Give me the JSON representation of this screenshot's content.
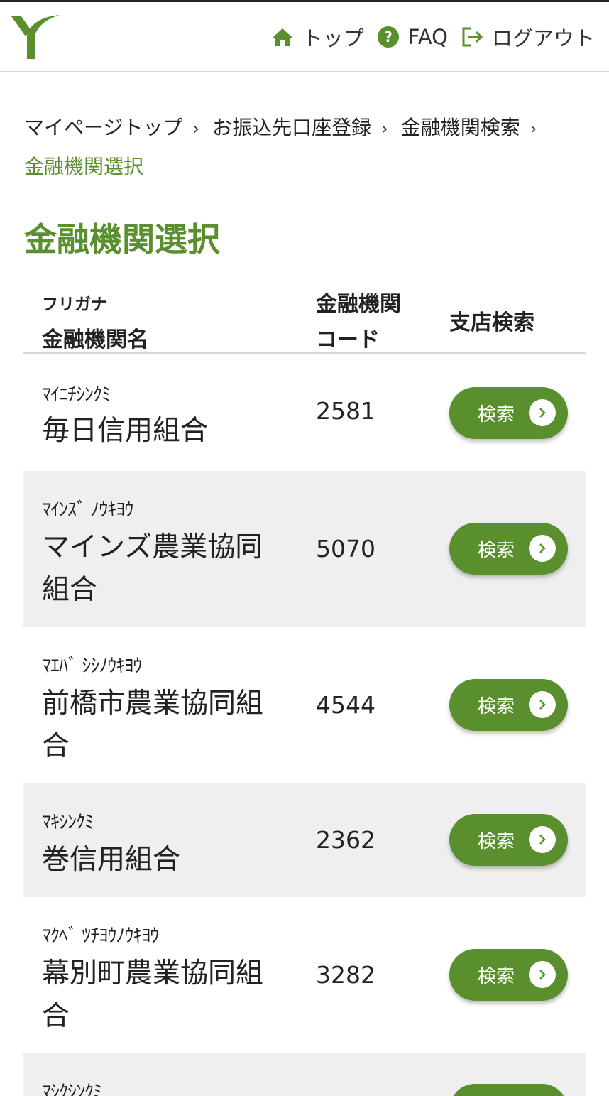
{
  "header": {
    "nav": [
      {
        "label": "トップ",
        "icon": "home-icon"
      },
      {
        "label": "FAQ",
        "icon": "help-icon"
      },
      {
        "label": "ログアウト",
        "icon": "logout-icon"
      }
    ]
  },
  "colors": {
    "accent": "#5a8f2d",
    "row_alt": "#efefef"
  },
  "breadcrumb": {
    "items": [
      "マイページトップ",
      "お振込先口座登録",
      "金融機関検索"
    ],
    "current": "金融機関選択",
    "separator": "›"
  },
  "page": {
    "title": "金融機関選択"
  },
  "table": {
    "headers": {
      "kana": "フリガナ",
      "name": "金融機関名",
      "code_line1": "金融機関",
      "code_line2": "コード",
      "branch": "支店検索"
    },
    "button_label": "検索",
    "rows": [
      {
        "kana": "ﾏｲﾆﾁｼﾝｸﾐ",
        "name": "毎日信用組合",
        "code": "2581"
      },
      {
        "kana": "ﾏｲﾝｽﾞ ﾉｳｷﾖｳ",
        "name": "マインズ農業協同組合",
        "code": "5070"
      },
      {
        "kana": "ﾏｴﾊﾞ ｼｼﾉｳｷﾖｳ",
        "name": "前橋市農業協同組合",
        "code": "4544"
      },
      {
        "kana": "ﾏｷｼﾝｸﾐ",
        "name": "巻信用組合",
        "code": "2362"
      },
      {
        "kana": "ﾏｸﾍﾞ ﾂﾁﾖｳﾉｳｷﾖｳ",
        "name": "幕別町農業協同組合",
        "code": "3282"
      },
      {
        "kana": "ﾏｼｸｼﾝｸﾐ",
        "name": "",
        "code": ""
      }
    ]
  }
}
